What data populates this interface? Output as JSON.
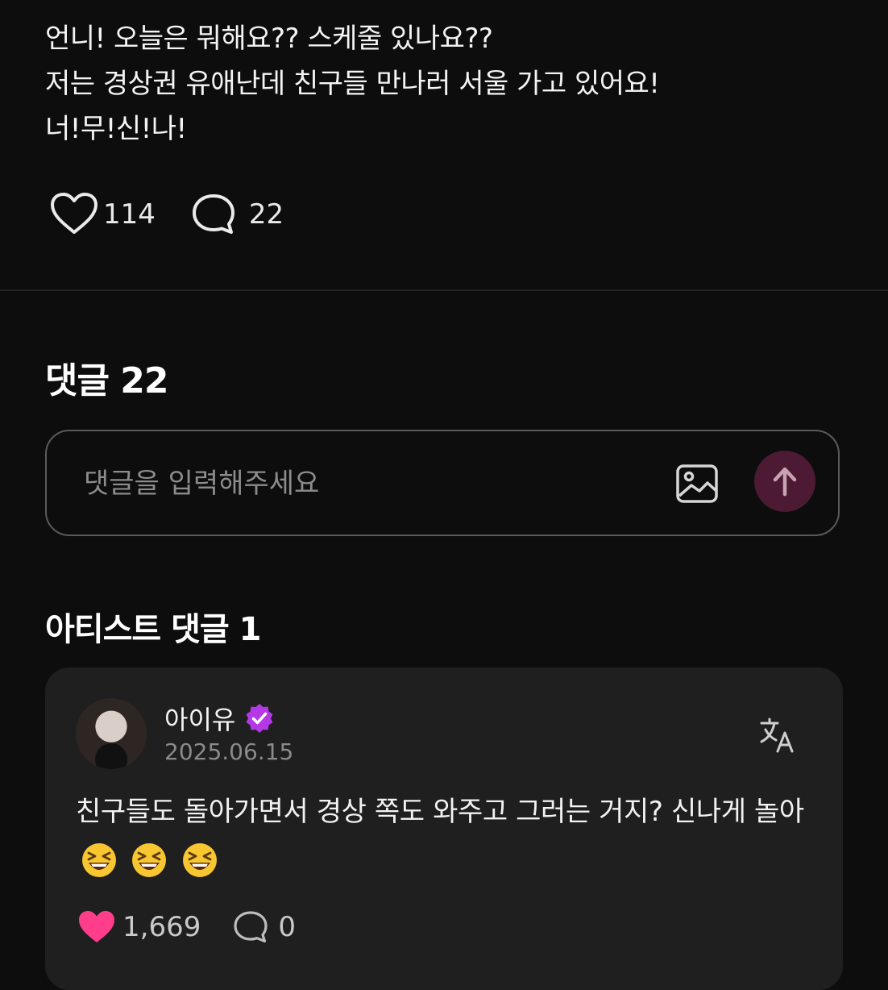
{
  "post": {
    "lines": [
      "언니! 오늘은 뭐해요?? 스케줄 있나요??",
      "저는 경상권 유애난데 친구들 만나러 서울 가고 있어요!",
      "너!무!신!나!"
    ],
    "like_count": "114",
    "comment_count": "22"
  },
  "comments_section": {
    "title": "댓글 22",
    "input_placeholder": "댓글을 입력해주세요"
  },
  "artist_section": {
    "title": "아티스트 댓글 1",
    "comment": {
      "author": "아이유",
      "date": "2025.06.15",
      "text": "친구들도 돌아가면서 경상 쪽도 와주고 그러는 거지? 신나게 놀아",
      "emojis": [
        "grinning-squinting-face",
        "grinning-squinting-face",
        "grinning-squinting-face"
      ],
      "like_count": "1,669",
      "reply_count": "0"
    }
  },
  "colors": {
    "background": "#0d0d0d",
    "card": "#1f1f1f",
    "like_active": "#ff3d8b",
    "send_button": "#4c1a32",
    "verified_badge": "#b438e6"
  }
}
